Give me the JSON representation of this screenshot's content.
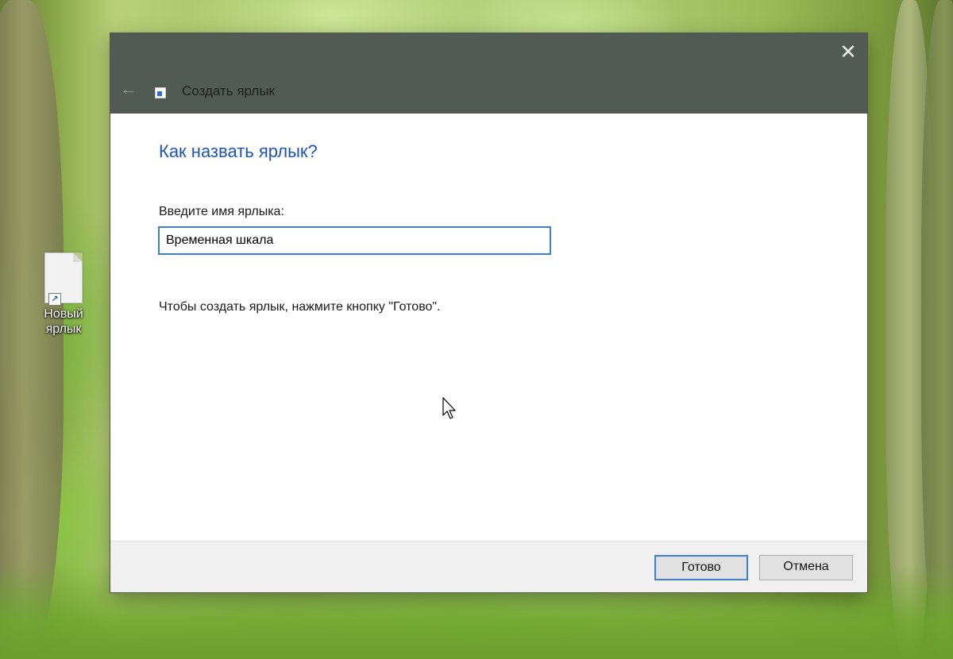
{
  "desktop": {
    "icon": {
      "label_line1": "Новый",
      "label_line2": "ярлык",
      "icon_name": "shortcut-file-icon"
    }
  },
  "window": {
    "title": "Создать ярлык",
    "close_glyph": "✕",
    "back_glyph": "←"
  },
  "content": {
    "heading": "Как назвать ярлык?",
    "name_label": "Введите имя ярлыка:",
    "name_value": "Временная шкала",
    "hint": "Чтобы создать ярлык, нажмите кнопку \"Готово\"."
  },
  "buttons": {
    "finish": "Готово",
    "cancel": "Отмена"
  },
  "colors": {
    "titlebar": "#525a54",
    "heading": "#1f54b3",
    "focus_border": "#3c7fd6"
  }
}
